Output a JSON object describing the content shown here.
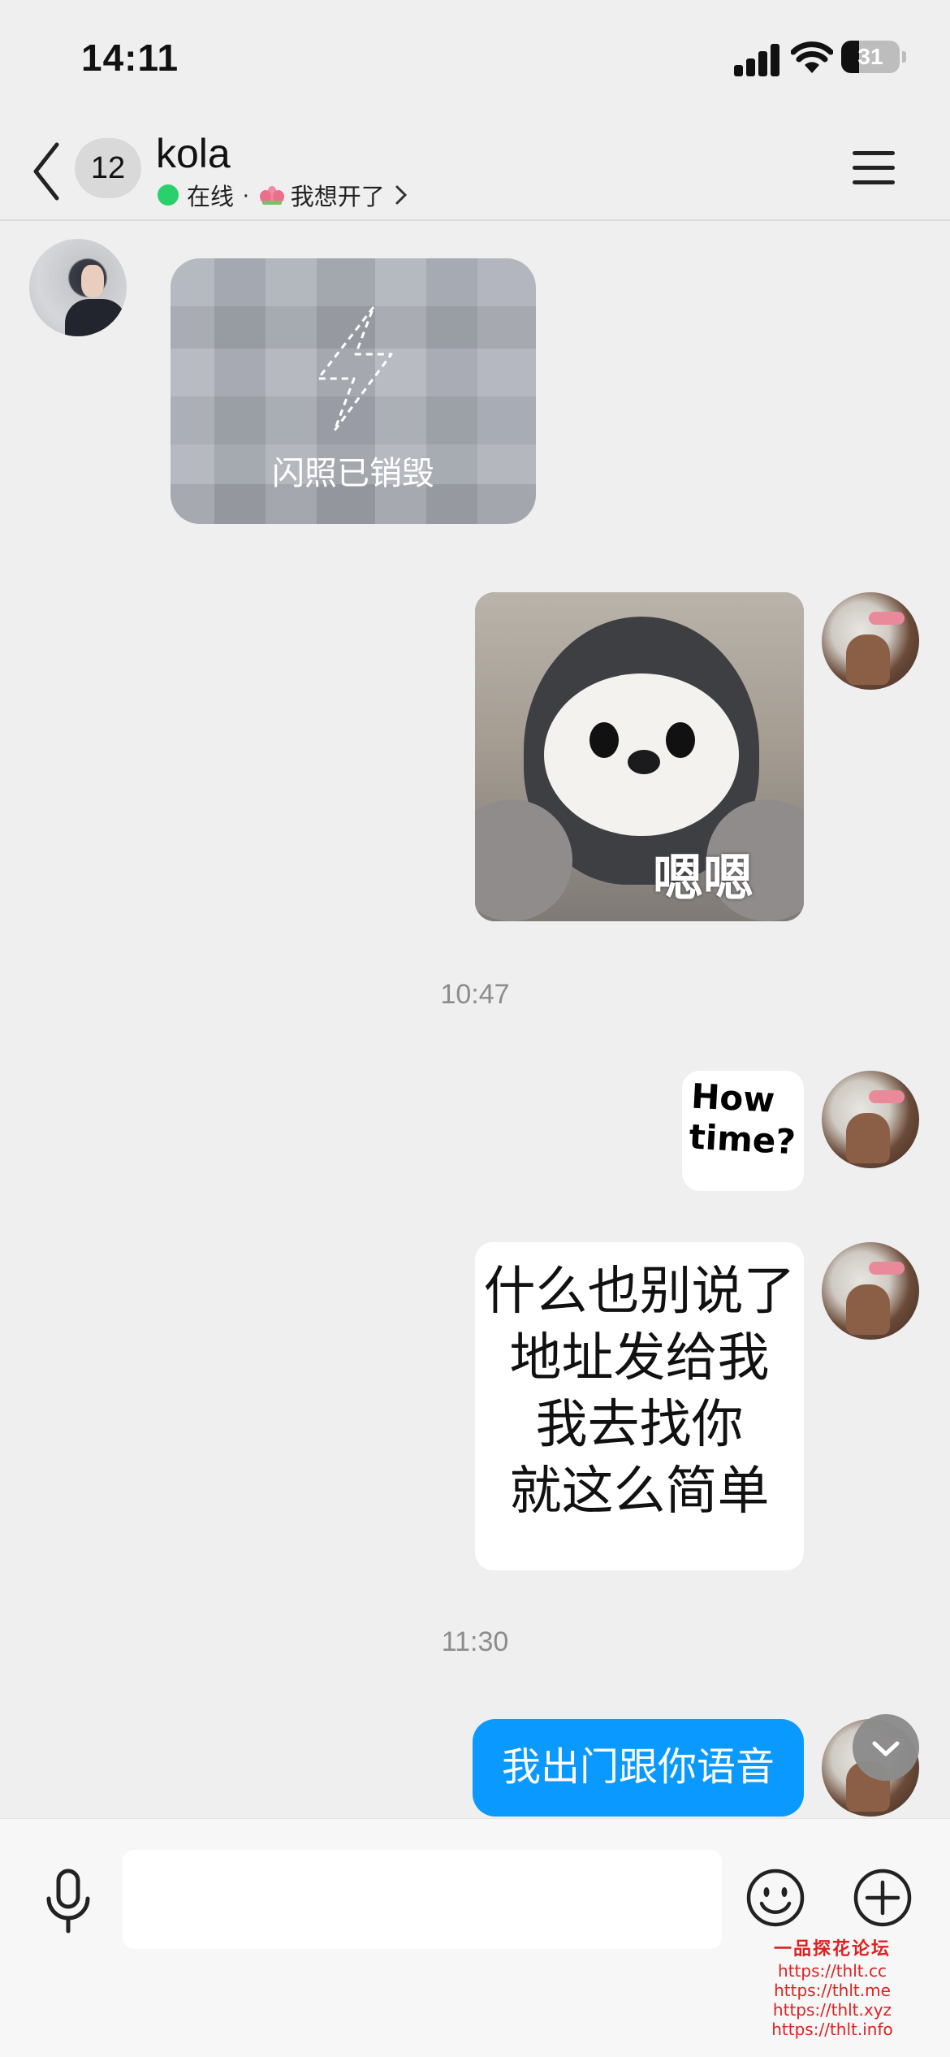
{
  "status_bar": {
    "time": "14:11",
    "battery": "31",
    "battery_level": 0.31
  },
  "header": {
    "back_count": "12",
    "contact_name": "kola",
    "online_text": "在线",
    "separator": "·",
    "status_text": "我想开了"
  },
  "messages": [
    {
      "sender": "contact",
      "type": "flash_photo",
      "label": "闪照已销毁"
    },
    {
      "sender": "me",
      "type": "sticker",
      "caption": "嗯嗯"
    },
    {
      "type": "timestamp",
      "text": "10:47"
    },
    {
      "sender": "me",
      "type": "sticker",
      "lines": [
        "How",
        "time?"
      ]
    },
    {
      "sender": "me",
      "type": "sticker",
      "lines": [
        "什么也别说了",
        "地址发给我",
        "我去找你",
        "就这么简单"
      ]
    },
    {
      "type": "timestamp",
      "text": "11:30"
    },
    {
      "sender": "me",
      "type": "text",
      "text": "我出门跟你语音"
    }
  ],
  "composer": {
    "value": "",
    "placeholder": ""
  },
  "watermark": {
    "title": "一品探花论坛",
    "urls": [
      "https://thlt.cc",
      "https://thlt.me",
      "https://thlt.xyz",
      "https://thlt.info"
    ]
  },
  "icons": {
    "back": "chevron-left-icon",
    "menu": "hamburger-icon",
    "status": "lotus-icon",
    "voice": "microphone-icon",
    "emoji": "smiley-icon",
    "more": "plus-circle-icon",
    "scroll": "chevron-down-icon"
  },
  "colors": {
    "bubble": "#0a99ff",
    "online": "#2ad06a",
    "background": "#efefef"
  }
}
